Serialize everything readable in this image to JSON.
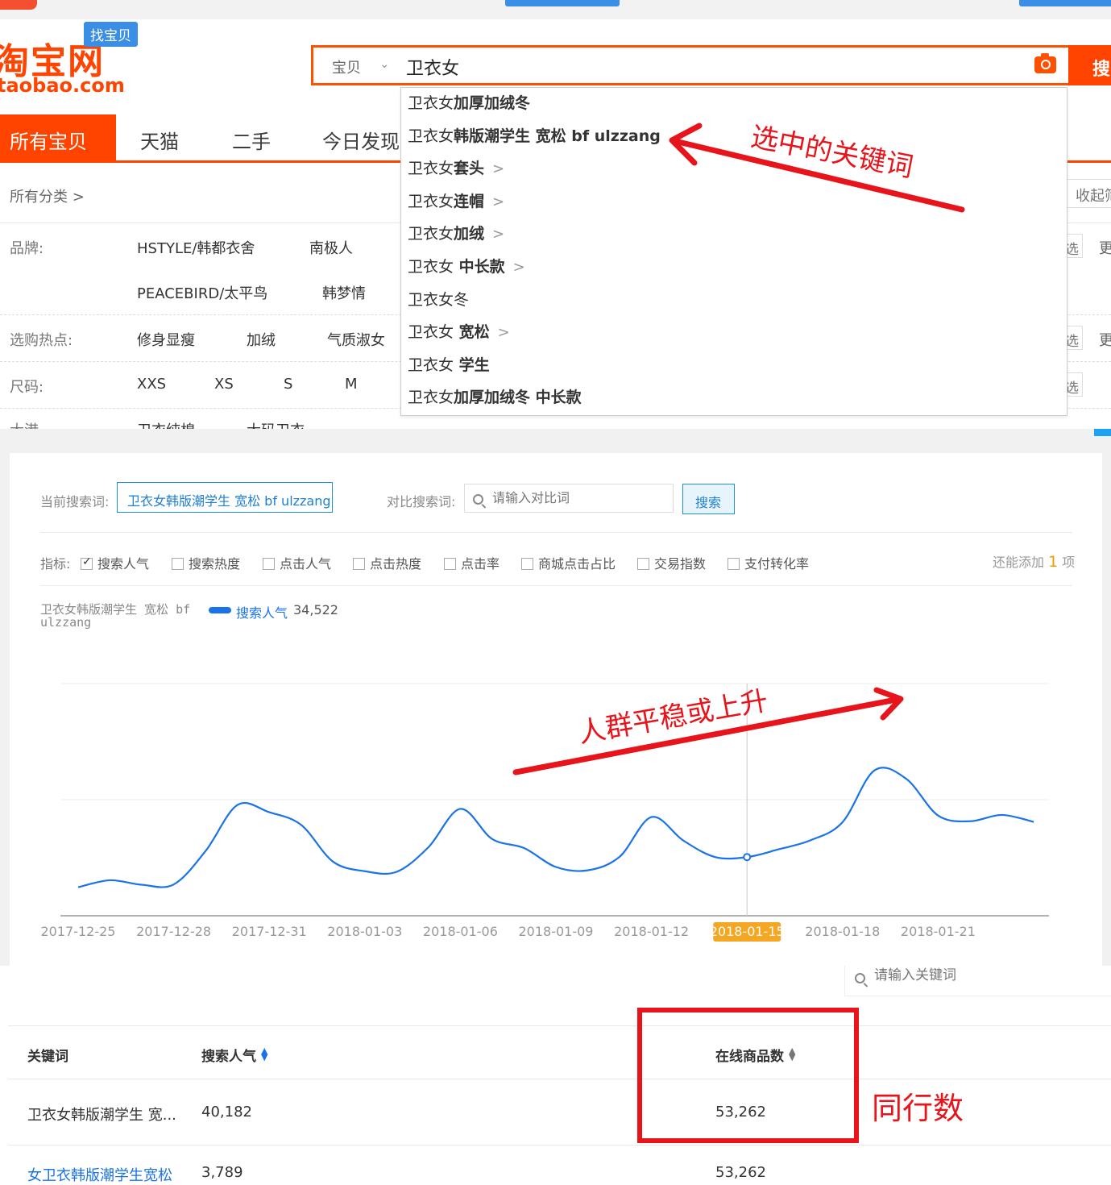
{
  "colors": {
    "taobao_orange": "#ff4400",
    "accent_blue": "#1a73e8",
    "annotation_red": "#e8141b",
    "highlight_date": "#f5a623"
  },
  "taobao": {
    "logo_text": "淘宝网",
    "logo_domain": "taobao.com",
    "logo_badge": "找宝贝",
    "search_category": "宝贝",
    "search_value": "卫衣女",
    "search_button": "搜",
    "tabs": [
      "所有宝贝",
      "天猫",
      "二手",
      "今日发现"
    ],
    "all_categories": "所有分类 >",
    "collapse": "收起筛",
    "filters": {
      "brand_label": "品牌:",
      "brand_values": [
        "HSTYLE/韩都衣舍",
        "南极人",
        "PEACEBIRD/太平鸟",
        "韩梦情"
      ],
      "hot_label": "选购热点:",
      "hot_values": [
        "修身显瘦",
        "加绒",
        "气质淑女"
      ],
      "size_label": "尺码:",
      "size_values": [
        "XXS",
        "XS",
        "S",
        "M"
      ],
      "clipped_label": "大港",
      "clipped_values": [
        "卫衣纯棉",
        "大码卫衣"
      ],
      "right_select": "选",
      "right_more": "更"
    },
    "suggestions": [
      {
        "base": "卫衣女",
        "bold": "加厚加绒冬",
        "chevron": ""
      },
      {
        "base": "卫衣女",
        "bold": "韩版潮学生 宽松 bf ulzzang",
        "chevron": ""
      },
      {
        "base": "卫衣女",
        "bold": "套头",
        "chevron": ">"
      },
      {
        "base": "卫衣女",
        "bold": "连帽",
        "chevron": ">"
      },
      {
        "base": "卫衣女",
        "bold": "加绒",
        "chevron": ">"
      },
      {
        "base": "卫衣女",
        "bold": " 中长款",
        "chevron": ">"
      },
      {
        "base": "卫衣女冬",
        "bold": "",
        "chevron": ""
      },
      {
        "base": "卫衣女",
        "bold": " 宽松",
        "chevron": ">"
      },
      {
        "base": "卫衣女",
        "bold": " 学生",
        "chevron": ""
      },
      {
        "base": "卫衣女",
        "bold": "加厚加绒冬 中长款",
        "chevron": ""
      }
    ],
    "annotation_selected": "选中的关键词"
  },
  "analysis": {
    "current_label": "当前搜索词:",
    "current_term": "卫衣女韩版潮学生 宽松 bf ulzzang",
    "compare_label": "对比搜索词:",
    "compare_placeholder": "请输入对比词",
    "compare_button": "搜索",
    "metrics_label": "指标:",
    "metrics": [
      {
        "label": "搜索人气",
        "checked": true
      },
      {
        "label": "搜索热度",
        "checked": false
      },
      {
        "label": "点击人气",
        "checked": false
      },
      {
        "label": "点击热度",
        "checked": false
      },
      {
        "label": "点击率",
        "checked": false
      },
      {
        "label": "商城点击占比",
        "checked": false
      },
      {
        "label": "交易指数",
        "checked": false
      },
      {
        "label": "支付转化率",
        "checked": false
      }
    ],
    "add_note_prefix": "还能添加",
    "add_note_count": "1",
    "add_note_suffix": "项",
    "legend_term": "卫衣女韩版潮学生 宽松 bf ulzzang",
    "legend_series": "搜索人气",
    "legend_value": "34,522",
    "annotation_trend": "人群平稳或上升"
  },
  "chart_data": {
    "type": "line",
    "x": [
      "2017-12-25",
      "2017-12-26",
      "2017-12-27",
      "2017-12-28",
      "2017-12-29",
      "2017-12-30",
      "2017-12-31",
      "2018-01-01",
      "2018-01-02",
      "2018-01-03",
      "2018-01-04",
      "2018-01-05",
      "2018-01-06",
      "2018-01-07",
      "2018-01-08",
      "2018-01-09",
      "2018-01-10",
      "2018-01-11",
      "2018-01-12",
      "2018-01-13",
      "2018-01-14",
      "2018-01-15",
      "2018-01-16",
      "2018-01-17",
      "2018-01-18",
      "2018-01-19",
      "2018-01-20",
      "2018-01-21",
      "2018-01-22",
      "2018-01-23",
      "2018-01-24"
    ],
    "tick_labels": [
      "2017-12-25",
      "2017-12-28",
      "2017-12-31",
      "2018-01-03",
      "2018-01-06",
      "2018-01-09",
      "2018-01-12",
      "2018-01-15",
      "2018-01-18",
      "2018-01-21"
    ],
    "highlighted_tick": "2018-01-15",
    "series": [
      {
        "name": "搜索人气",
        "values": [
          24500,
          26800,
          25300,
          25400,
          36500,
          51800,
          49400,
          45200,
          33000,
          29800,
          29600,
          37800,
          50500,
          40500,
          37500,
          31200,
          30100,
          34600,
          47800,
          40000,
          34500,
          34500,
          37100,
          40100,
          46100,
          63300,
          60500,
          48300,
          46400,
          48500,
          46200
        ]
      },
      {
        "name": "_placeholder_",
        "values": []
      }
    ],
    "ylim": [
      15000,
      105000
    ],
    "grid": true
  },
  "keywords": {
    "search_placeholder": "请输入关键词",
    "columns": [
      "关键词",
      "搜索人气",
      "在线商品数"
    ],
    "rows": [
      {
        "keyword": "卫衣女韩版潮学生 宽...",
        "popularity": "40,182",
        "online_items": "53,262"
      },
      {
        "keyword": "女卫衣韩版潮学生宽松",
        "popularity": "3,789",
        "online_items": "53,262"
      }
    ],
    "annotation_competitors": "同行数"
  }
}
